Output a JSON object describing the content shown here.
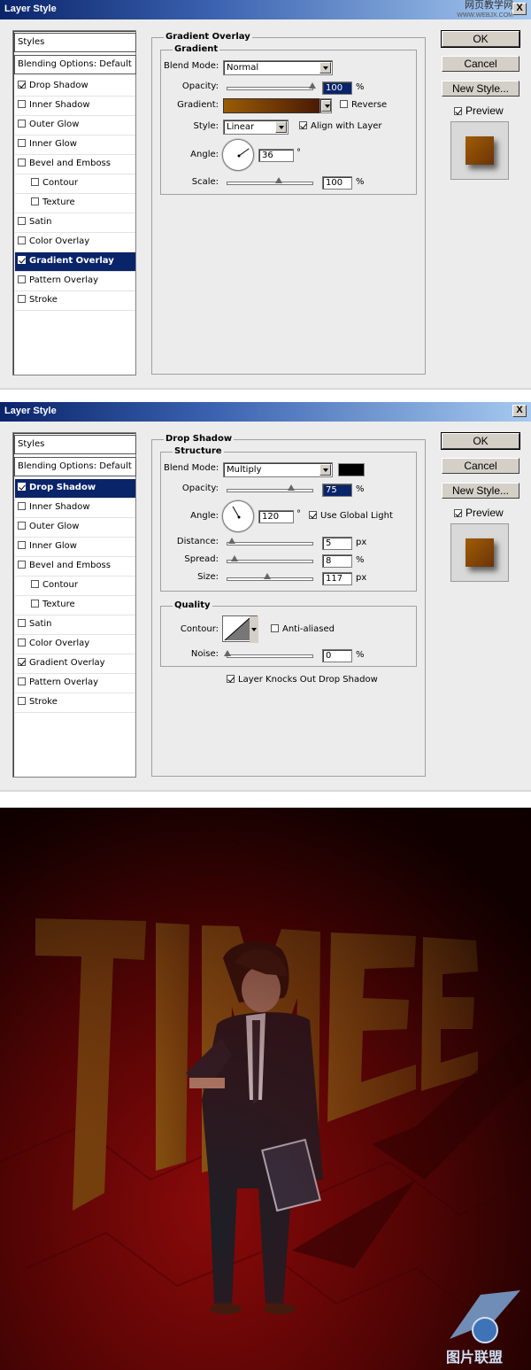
{
  "dialog1": {
    "title": "Layer Style",
    "close": "X",
    "watermark": "网页教学网",
    "watermark_url": "WWW.WEBJX.COM",
    "styles": [
      {
        "label": "Styles",
        "checked": null,
        "header": true
      },
      {
        "label": "Blending Options: Default",
        "checked": null,
        "header": true
      },
      {
        "label": "Drop Shadow",
        "checked": true
      },
      {
        "label": "Inner Shadow",
        "checked": false
      },
      {
        "label": "Outer Glow",
        "checked": false
      },
      {
        "label": "Inner Glow",
        "checked": false
      },
      {
        "label": "Bevel and Emboss",
        "checked": false
      },
      {
        "label": "Contour",
        "checked": false,
        "indent": true
      },
      {
        "label": "Texture",
        "checked": false,
        "indent": true
      },
      {
        "label": "Satin",
        "checked": false
      },
      {
        "label": "Color Overlay",
        "checked": false
      },
      {
        "label": "Gradient Overlay",
        "checked": true,
        "selected": true
      },
      {
        "label": "Pattern Overlay",
        "checked": false
      },
      {
        "label": "Stroke",
        "checked": false
      }
    ],
    "panel_title": "Gradient Overlay",
    "group_title": "Gradient",
    "blend_mode_label": "Blend Mode:",
    "blend_mode": "Normal",
    "opacity_label": "Opacity:",
    "opacity": "100",
    "opacity_level": 1.0,
    "percent": "%",
    "gradient_label": "Gradient:",
    "reverse_label": "Reverse",
    "reverse": false,
    "style_label": "Style:",
    "style": "Linear",
    "align_label": "Align with Layer",
    "align": true,
    "angle_label": "Angle:",
    "angle": "36",
    "degree": "°",
    "scale_label": "Scale:",
    "scale": "100",
    "scale_level": 0.6,
    "colors": {
      "gradient_start": "#9a5b06",
      "gradient_end": "#4a1a04"
    }
  },
  "dialog2": {
    "title": "Layer Style",
    "close": "X",
    "styles": [
      {
        "label": "Styles",
        "checked": null,
        "header": true
      },
      {
        "label": "Blending Options: Default",
        "checked": null,
        "header": true
      },
      {
        "label": "Drop Shadow",
        "checked": true,
        "selected": true
      },
      {
        "label": "Inner Shadow",
        "checked": false
      },
      {
        "label": "Outer Glow",
        "checked": false
      },
      {
        "label": "Inner Glow",
        "checked": false
      },
      {
        "label": "Bevel and Emboss",
        "checked": false
      },
      {
        "label": "Contour",
        "checked": false,
        "indent": true
      },
      {
        "label": "Texture",
        "checked": false,
        "indent": true
      },
      {
        "label": "Satin",
        "checked": false
      },
      {
        "label": "Color Overlay",
        "checked": false
      },
      {
        "label": "Gradient Overlay",
        "checked": true
      },
      {
        "label": "Pattern Overlay",
        "checked": false
      },
      {
        "label": "Stroke",
        "checked": false
      }
    ],
    "panel_title": "Drop Shadow",
    "structure_title": "Structure",
    "blend_mode_label": "Blend Mode:",
    "blend_mode": "Multiply",
    "opacity_label": "Opacity:",
    "opacity": "75",
    "opacity_level": 0.75,
    "percent": "%",
    "angle_label": "Angle:",
    "angle": "120",
    "degree": "°",
    "global_light_label": "Use Global Light",
    "global_light": true,
    "distance_label": "Distance:",
    "distance": "5",
    "distance_level": 0.05,
    "spread_label": "Spread:",
    "spread": "8",
    "spread_level": 0.08,
    "size_label": "Size:",
    "size": "117",
    "size_level": 0.47,
    "px": "px",
    "quality_title": "Quality",
    "contour_label": "Contour:",
    "anti_aliased_label": "Anti-aliased",
    "anti_aliased": false,
    "noise_label": "Noise:",
    "noise": "0",
    "noise_level": 0.0,
    "knockout_label": "Layer Knocks Out Drop Shadow",
    "knockout": true,
    "shadow_color": "#000000"
  },
  "buttons": {
    "ok": "OK",
    "cancel": "Cancel",
    "new_style": "New Style...",
    "preview": "Preview",
    "preview_checked": true
  },
  "artwork": {
    "headline": "TIME",
    "headline_color": "#9a6a12",
    "logo_text": "图片联盟"
  }
}
